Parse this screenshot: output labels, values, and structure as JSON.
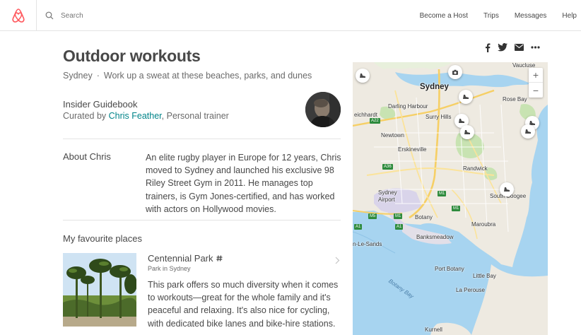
{
  "header": {
    "search_placeholder": "Search",
    "nav": [
      "Become a Host",
      "Trips",
      "Messages",
      "Help"
    ]
  },
  "share": {
    "icons": [
      "facebook-icon",
      "twitter-icon",
      "email-icon",
      "more-icon"
    ]
  },
  "guide": {
    "title": "Outdoor workouts",
    "city": "Sydney",
    "separator": "·",
    "tagline": "Work up a sweat at these beaches, parks, and dunes",
    "guidebook_label": "Insider Guidebook",
    "curated_prefix": "Curated by ",
    "curator_name": "Chris Feather",
    "curator_suffix": ", Personal trainer"
  },
  "about": {
    "label": "About Chris",
    "text": "An elite rugby player in Europe for 12 years, Chris moved to Sydney and launched his exclusive 98 Riley Street Gym in 2011. He manages top trainers, is Gym Jones-certified, and has worked with actors on Hollywood movies."
  },
  "favourites": {
    "heading": "My favourite places",
    "places": [
      {
        "name": "Centennial Park",
        "type": "Park in Sydney",
        "description": "This park offers so much diversity when it comes to workouts—great for the whole family and it's peaceful and relaxing. It's also nice for cycling, with dedicated bike lanes and bike-hire stations."
      }
    ]
  },
  "map": {
    "zoom_in": "+",
    "zoom_out": "−",
    "labels": {
      "sydney": "Sydney",
      "darling_harbour": "Darling Harbour",
      "surry_hills": "Surry Hills",
      "leichhardt": "eichhardt",
      "newtown": "Newtown",
      "erskineville": "Erskineville",
      "randwick": "Randwick",
      "sydney_airport": "Sydney\nAirport",
      "botany": "Botany",
      "banksmeadow": "Banksmeadow",
      "maroubra": "Maroubra",
      "coogee": "South Coogee",
      "rose_bay": "Rose Bay",
      "vaucluse": "Vaucluse",
      "le_sands": "n-Le-Sands",
      "port_botany": "Port Botany",
      "little_bay": "Little Bay",
      "la_perouse": "La Perouse",
      "kurnell": "Kurnell",
      "botany_bay": "Botany Bay"
    },
    "road_shields": [
      "A22",
      "A36",
      "M1",
      "M1",
      "M5",
      "A1",
      "M1",
      "A1"
    ]
  }
}
